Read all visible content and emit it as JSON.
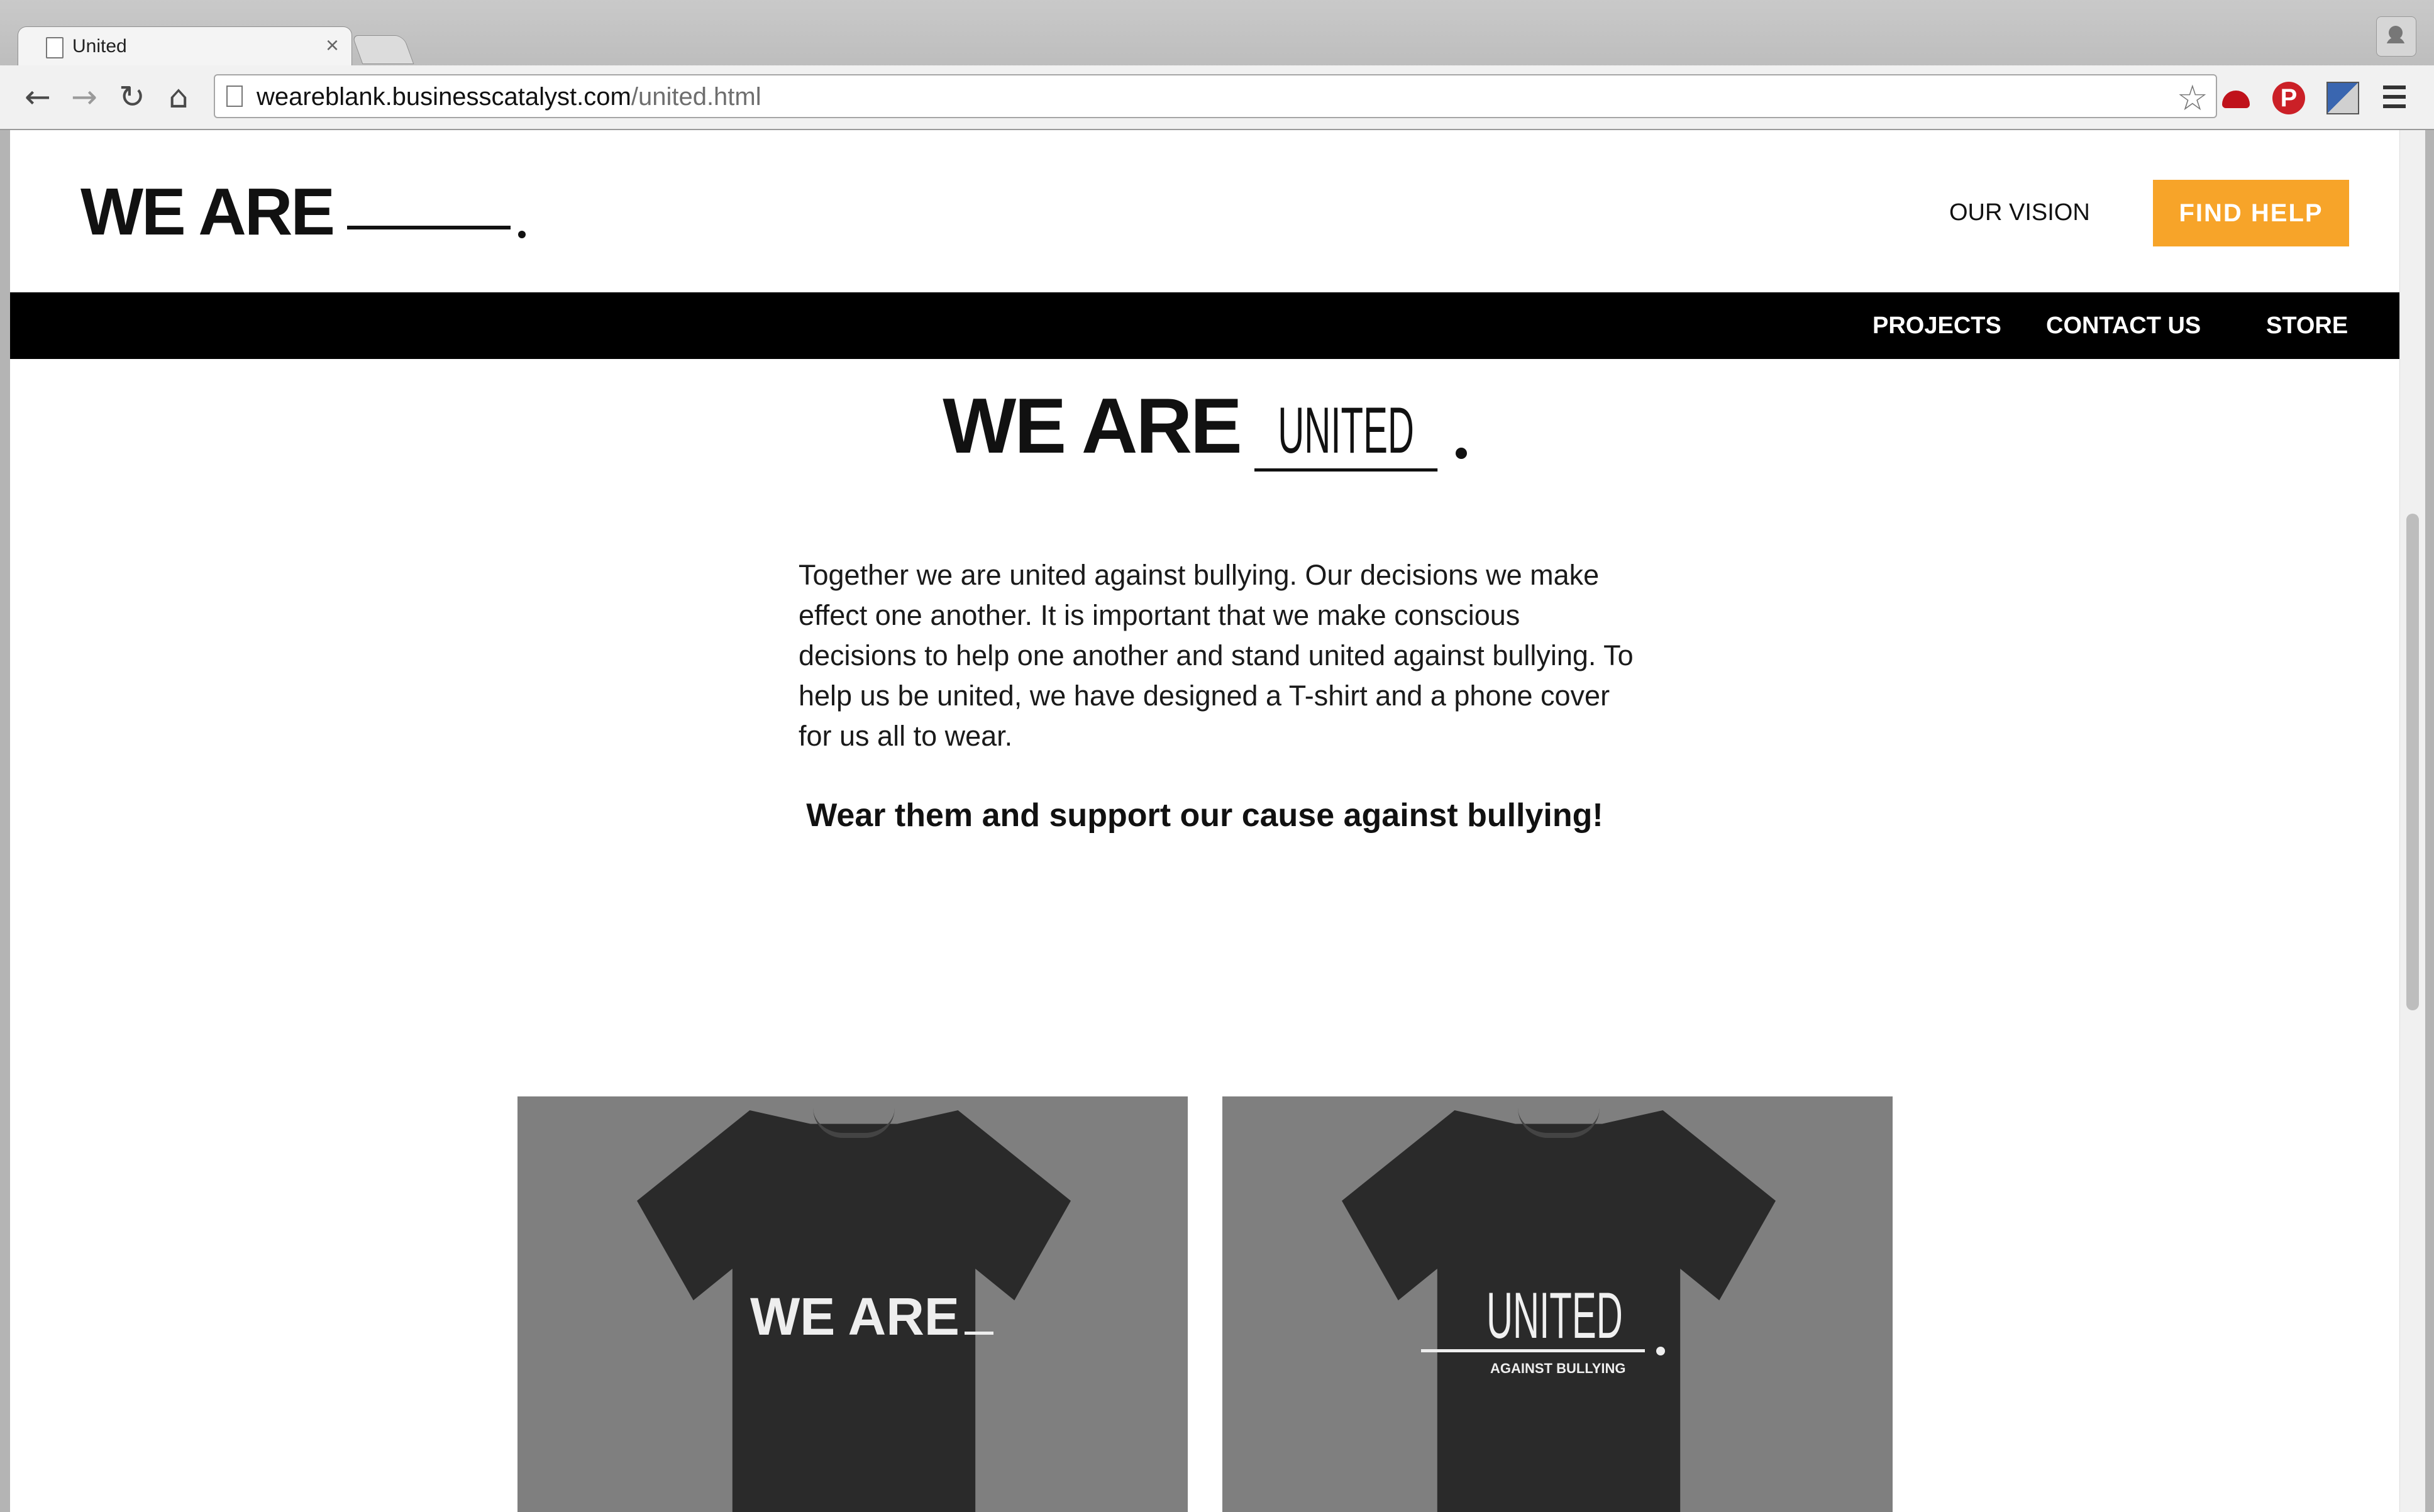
{
  "browser": {
    "tab_title": "United",
    "tab_close": "×",
    "url_host": "weareblank.businesscatalyst.com",
    "url_path": "/united.html",
    "nav": {
      "back": "←",
      "forward": "→",
      "reload": "↻",
      "home": "⌂"
    },
    "star": "☆",
    "pinterest": "P"
  },
  "header": {
    "logo": "WE ARE",
    "our_vision": "OUR VISION",
    "find_help": "FIND HELP",
    "accent_color": "#f7a429"
  },
  "nav": {
    "items": [
      "PROJECTS",
      "CONTACT US",
      "STORE"
    ]
  },
  "main": {
    "heading_prefix": "WE ARE",
    "heading_word": "UNITED",
    "body": "Together we are united against bullying. Our decisions we make effect one another. It is important that we make conscious decisions to help one another and stand united against bullying. To help us be united, we have designed a T-shirt and a phone cover for us all to wear.",
    "cta": "Wear them and support our cause against bullying!"
  },
  "products": [
    {
      "print": "WE ARE"
    },
    {
      "print": "UNITED",
      "sub": "AGAINST BULLYING"
    }
  ]
}
